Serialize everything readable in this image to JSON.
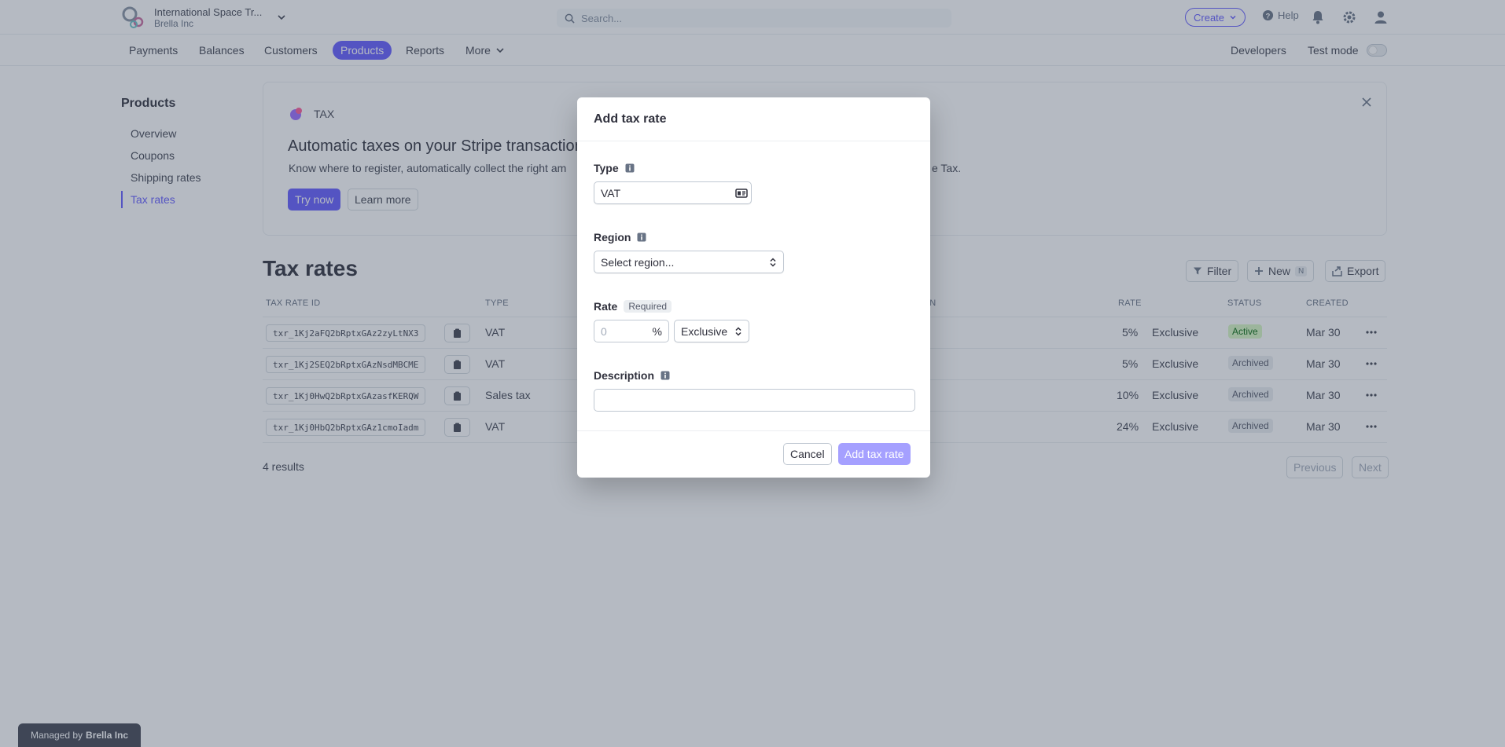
{
  "account": {
    "name": "International Space Tr...",
    "org": "Brella Inc"
  },
  "search": {
    "placeholder": "Search..."
  },
  "topbar": {
    "create_label": "Create",
    "help_label": "Help"
  },
  "nav": {
    "items": [
      "Payments",
      "Balances",
      "Customers",
      "Products",
      "Reports",
      "More"
    ],
    "active": "Products",
    "developers": "Developers",
    "test_mode": "Test mode"
  },
  "sidebar": {
    "title": "Products",
    "items": [
      "Overview",
      "Coupons",
      "Shipping rates",
      "Tax rates"
    ],
    "active": "Tax rates"
  },
  "banner": {
    "label": "TAX",
    "headline": "Automatic taxes on your Stripe transaction",
    "text": "Know where to register, automatically collect the right am",
    "text_tail": "e Tax.",
    "try_label": "Try now",
    "learn_label": "Learn more"
  },
  "tax_rates": {
    "title": "Tax rates",
    "filter_label": "Filter",
    "new_label": "New",
    "new_shortcut": "N",
    "export_label": "Export",
    "columns": {
      "id": "TAX RATE ID",
      "type": "TYPE",
      "description": "TION",
      "rate": "RATE",
      "status": "STATUS",
      "created": "CREATED"
    },
    "rows": [
      {
        "id": "txr_1Kj2aFQ2bRptxGAz2zyLtNX3",
        "type": "VAT",
        "rate": "5%",
        "inclusion": "Exclusive",
        "status": "Active",
        "created": "Mar 30"
      },
      {
        "id": "txr_1Kj2SEQ2bRptxGAzNsdMBCME",
        "type": "VAT",
        "rate": "5%",
        "inclusion": "Exclusive",
        "status": "Archived",
        "created": "Mar 30"
      },
      {
        "id": "txr_1Kj0HwQ2bRptxGAzasfKERQW",
        "type": "Sales tax",
        "rate": "10%",
        "inclusion": "Exclusive",
        "status": "Archived",
        "created": "Mar 30"
      },
      {
        "id": "txr_1Kj0HbQ2bRptxGAz1cmoIadm",
        "type": "VAT",
        "rate": "24%",
        "inclusion": "Exclusive",
        "status": "Archived",
        "created": "Mar 30"
      }
    ],
    "results": "4 results",
    "previous_label": "Previous",
    "next_label": "Next"
  },
  "managed": {
    "prefix": "Managed by",
    "org": "Brella Inc"
  },
  "modal": {
    "title": "Add tax rate",
    "type_label": "Type",
    "type_value": "VAT",
    "region_label": "Region",
    "region_value": "Select region...",
    "rate_label": "Rate",
    "rate_required": "Required",
    "rate_placeholder": "0",
    "rate_unit": "%",
    "inclusion_value": "Exclusive",
    "description_label": "Description",
    "description_value": "",
    "cancel_label": "Cancel",
    "submit_label": "Add tax rate"
  },
  "colors": {
    "accent": "#635bff",
    "active_badge_bg": "#d7f7c2",
    "active_badge_text": "#05690d"
  }
}
